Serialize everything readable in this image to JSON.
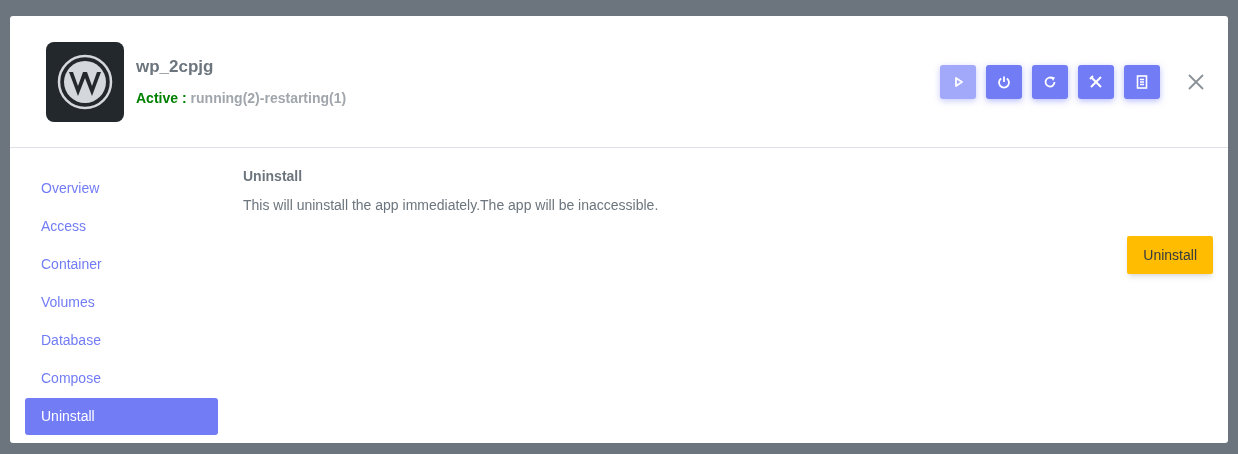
{
  "app": {
    "name": "wp_2cpjg",
    "status_label": "Active :",
    "status_detail": "running(2)-restarting(1)"
  },
  "toolbar": [
    {
      "kind": "play",
      "disabled": true
    },
    {
      "kind": "power",
      "disabled": false
    },
    {
      "kind": "restart",
      "disabled": false
    },
    {
      "kind": "tools",
      "disabled": false
    },
    {
      "kind": "document",
      "disabled": false
    }
  ],
  "sidebar": {
    "items": [
      {
        "label": "Overview",
        "selected": false
      },
      {
        "label": "Access",
        "selected": false
      },
      {
        "label": "Container",
        "selected": false
      },
      {
        "label": "Volumes",
        "selected": false
      },
      {
        "label": "Database",
        "selected": false
      },
      {
        "label": "Compose",
        "selected": false
      },
      {
        "label": "Uninstall",
        "selected": true
      }
    ]
  },
  "content": {
    "heading": "Uninstall",
    "description": "This will uninstall the app immediately.The app will be inaccessible.",
    "button": "Uninstall"
  }
}
